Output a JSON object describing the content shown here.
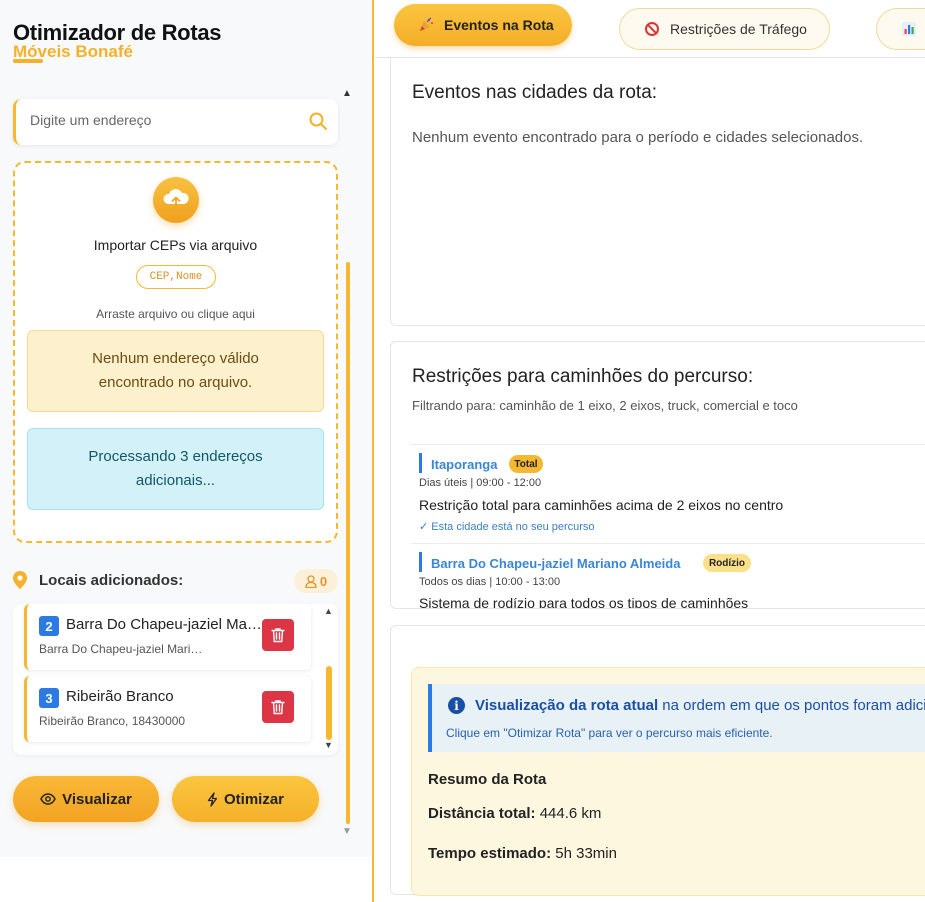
{
  "app": {
    "title": "Otimizador de Rotas",
    "subtitle": "Móveis Bonafé"
  },
  "search": {
    "placeholder": "Digite um endereço"
  },
  "import": {
    "title": "Importar CEPs via arquivo",
    "format": "CEP,Nome",
    "hint": "Arraste arquivo ou clique aqui",
    "warning": "Nenhum endereço válido encontrado no arquivo.",
    "info": "Processando 3 endereços adicionais..."
  },
  "locais": {
    "title": "Locais adicionados:",
    "count": "0",
    "items": [
      {
        "num": "2",
        "name": "Barra Do Chapeu-jaziel Mariano Almeida",
        "addr": "Barra Do Chapeu-jaziel Mariano Almeida"
      },
      {
        "num": "3",
        "name": "Ribeirão Branco",
        "addr": "Ribeirão Branco, 18430000"
      }
    ]
  },
  "actions": {
    "visualizar": "Visualizar",
    "otimizar": "Otimizar"
  },
  "tabs": [
    {
      "label": "Eventos na Rota",
      "icon": "party-popper-icon"
    },
    {
      "label": "Restrições de Tráfego",
      "icon": "no-entry-icon"
    },
    {
      "label": "",
      "icon": "bar-chart-icon"
    }
  ],
  "events": {
    "title": "Eventos nas cidades da rota:",
    "empty": "Nenhum evento encontrado para o período e cidades selecionados."
  },
  "restrictions": {
    "title": "Restrições para caminhões do percurso:",
    "filter": "Filtrando para: caminhão de 1 eixo, 2 eixos, truck, comercial e toco",
    "items": [
      {
        "city": "Itaporanga",
        "badge": "Total",
        "badge_color": "#f5b830",
        "time": "Dias úteis | 09:00 - 12:00",
        "desc": "Restrição total para caminhões acima de 2 eixos no centro",
        "note": "✓ Esta cidade está no seu percurso"
      },
      {
        "city": "Barra Do Chapeu-jaziel Mariano Almeida",
        "badge": "Rodízio",
        "badge_color": "#fbe08a",
        "time": "Todos os dias | 10:00 - 13:00",
        "desc": "Sistema de rodízio para todos os tipos de caminhões",
        "note": ""
      }
    ]
  },
  "summary": {
    "info_bold": "Visualização da rota atual",
    "info_rest": " na ordem em que os pontos foram adicionados",
    "info_hint": "Clique em \"Otimizar Rota\" para ver o percurso mais eficiente.",
    "heading": "Resumo da Rota",
    "distance_label": "Distância total:",
    "distance_value": " 444.6 km",
    "time_label": "Tempo estimado:",
    "time_value": " 5h 33min"
  },
  "colors": {
    "accent": "#f5b830",
    "primary_blue": "#2c7be5",
    "danger": "#dc3545"
  }
}
